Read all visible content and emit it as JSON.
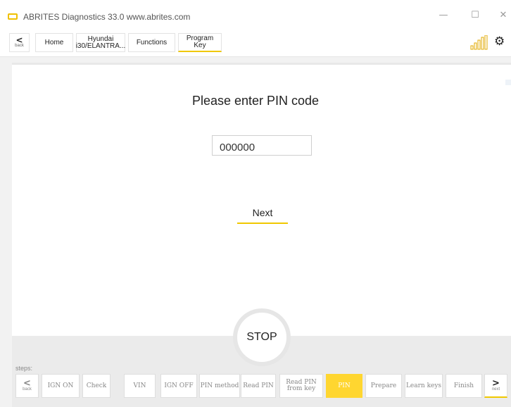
{
  "window": {
    "title": "ABRITES Diagnostics 33.0   www.abrites.com",
    "minimize": "—",
    "maximize": "☐",
    "close": "✕"
  },
  "toolbar": {
    "back_arrow": "<",
    "back_label": "back",
    "home": "Home",
    "vehicle": [
      "Hyundai",
      "i30/ELANTRA..."
    ],
    "functions": "Functions",
    "program_key": [
      "Program",
      "Key"
    ],
    "signal_icon": "signal-strength-icon",
    "settings_icon": "⚙"
  },
  "main": {
    "prompt": "Please enter PIN code",
    "pin_value": "000000",
    "next_label": "Next",
    "stop_label": "STOP"
  },
  "steps": {
    "label": "steps:",
    "back_arrow": "<",
    "back_label": "back",
    "next_arrow": ">",
    "next_label": "next",
    "items": [
      "IGN ON",
      "Check",
      "VIN",
      "IGN OFF",
      "PIN method",
      "Read PIN",
      "Read PIN from key",
      "PIN",
      "Prepare",
      "Learn keys",
      "Finish"
    ],
    "read_pin_from_key": [
      "Read PIN",
      "from key"
    ],
    "active_step": "PIN"
  },
  "colors": {
    "accent": "#f0c800",
    "active_step_bg": "#ffd630"
  }
}
